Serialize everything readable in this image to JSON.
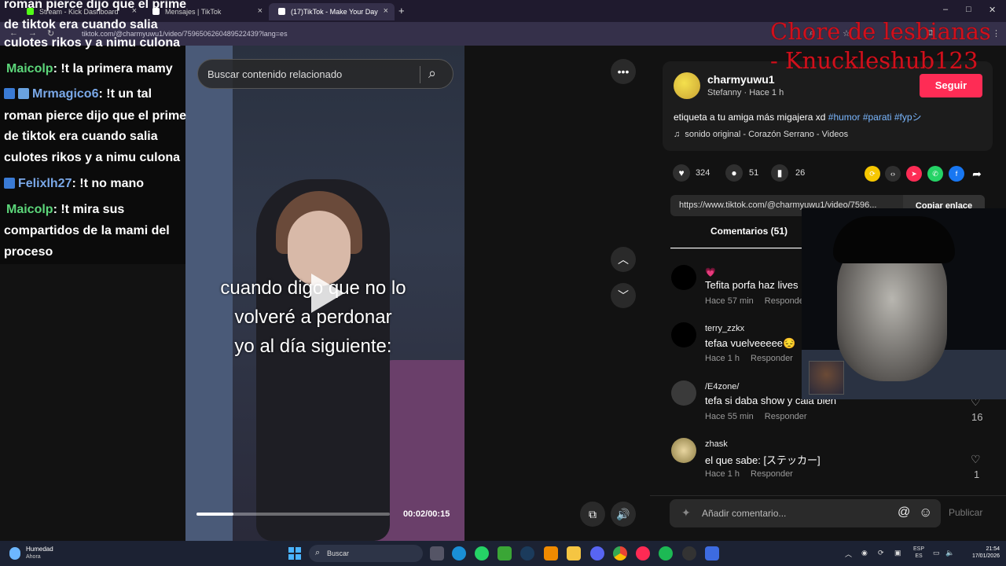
{
  "browser": {
    "tabs": [
      {
        "label": "Stream - Kick Dashboard",
        "color": "#53fc18"
      },
      {
        "label": "Mensajes | TikTok",
        "color": "#ffffff"
      },
      {
        "label": "(17)TikTok - Make Your Day",
        "color": "#ffffff"
      }
    ],
    "new_tab": "+",
    "url": "tiktok.com/@charmyuwu1/video/7596506260489522439?lang=es"
  },
  "chat": {
    "lines": [
      {
        "text": "roman pierce dijo que el prime"
      },
      {
        "text": "de tiktok era cuando salia"
      },
      {
        "text": "culotes rikos y a nimu culona"
      },
      {
        "nick": "Maicolp",
        "msg": ": !t la primera mamy"
      },
      {
        "nick": "Mrmagico6",
        "msg": ": !t un tal"
      },
      {
        "text": "roman pierce dijo que el prime"
      },
      {
        "text": "de tiktok era cuando salia"
      },
      {
        "text": "culotes rikos y a nimu culona"
      },
      {
        "nick": "Felixlh27",
        "msg": ": !t no mano"
      },
      {
        "nick": "Maicolp",
        "msg": ": !t mira sus"
      },
      {
        "text": "compartidos de la mami del"
      },
      {
        "text": "proceso"
      }
    ]
  },
  "video": {
    "search_placeholder": "Buscar contenido relacionado",
    "caption": [
      "cuando digo que no lo",
      "volveré a perdonar",
      "yo al día siguiente:"
    ],
    "time": "00:02/00:15",
    "progress": 0.19
  },
  "post": {
    "username": "charmyuwu1",
    "display_name": "Stefanny · Hace 1 h",
    "follow_label": "Seguir",
    "description": "etiqueta a tu amiga más migajera xd",
    "hashtags": [
      "#humor",
      "#parati",
      "#fypシ"
    ],
    "music": "sonido original - Corazón Serrano - Videos",
    "likes": "324",
    "comments": "51",
    "saves": "26",
    "link": "https://www.tiktok.com/@charmyuwu1/video/7596...",
    "copy_label": "Copiar enlace",
    "comments_tab": "Comentarios (51)",
    "accent": "#fe2c55"
  },
  "comments": [
    {
      "name": "💗",
      "text": "Tefita porfa haz lives",
      "time": "Hace 57 min",
      "reply": "Responder"
    },
    {
      "name": "terry_zzkx",
      "text": "tefaa vuelveeeee😔",
      "time": "Hace 1 h",
      "reply": "Responder"
    },
    {
      "name": "/E4zone/",
      "text": "tefa si daba show y caia bien",
      "time": "Hace 55 min",
      "reply": "Responder",
      "likes": "16"
    },
    {
      "name": "zhask",
      "text": "el que sabe: [ステッカー]",
      "time": "Hace 1 h",
      "reply": "Responder",
      "likes": "1"
    }
  ],
  "composer": {
    "placeholder": "Añadir comentario...",
    "publish": "Publicar"
  },
  "watermark": {
    "line1": "Chore de lesbianas",
    "line2": "- Knuckleshub123"
  },
  "taskbar": {
    "weather_title": "Humedad",
    "weather_sub": "Ahora",
    "search": "Buscar",
    "lang1": "ESP",
    "lang2": "ES",
    "time": "21:54",
    "date": "17/01/2026"
  }
}
